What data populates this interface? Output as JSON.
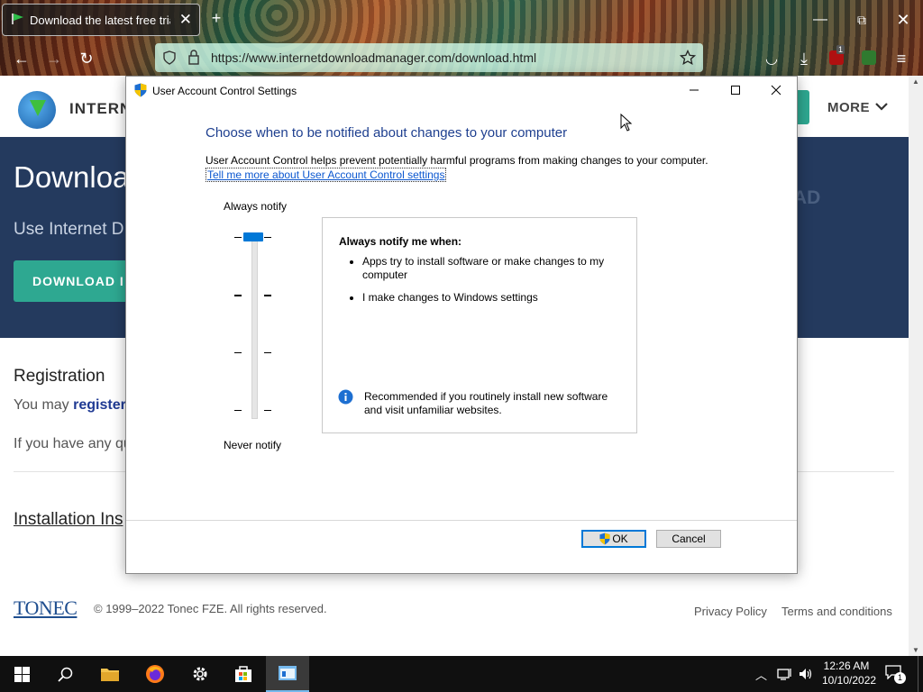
{
  "browser": {
    "tab_title": "Download the latest free trial v",
    "url": "https://www.internetdownloadmanager.com/download.html",
    "ublock_count": "1"
  },
  "site": {
    "brand": "INTERN",
    "more_label": "MORE",
    "hero_title": "Downloa",
    "hero_sub": "Use Internet D",
    "hero_right": "AD",
    "download_button": "DOWNLOAD I",
    "registration_heading": "Registration",
    "registration_text": "You may ",
    "register_link": "register",
    "contact_text": "If you have any qu",
    "installation_heading": "Installation Ins",
    "footer_logo": "TONEC",
    "copyright": "© 1999–2022 Tonec FZE. All rights reserved.",
    "privacy_policy": "Privacy Policy",
    "terms": "Terms and conditions"
  },
  "dialog": {
    "title": "User Account Control Settings",
    "heading": "Choose when to be notified about changes to your computer",
    "description": "User Account Control helps prevent potentially harmful programs from making changes to your computer.",
    "link": "Tell me more about User Account Control settings",
    "slider_top_label": "Always notify",
    "slider_bottom_label": "Never notify",
    "slider_level": 4,
    "slider_levels": 4,
    "info_title": "Always notify me when:",
    "bullets": [
      "Apps try to install software or make changes to my computer",
      "I make changes to Windows settings"
    ],
    "recommendation": "Recommended if you routinely install new software and visit unfamiliar websites.",
    "ok_label": "OK",
    "cancel_label": "Cancel"
  },
  "taskbar": {
    "time": "12:26 AM",
    "date": "10/10/2022",
    "notification_count": "1"
  },
  "colors": {
    "accent": "#0078d7",
    "hero_bg": "#243a5e",
    "download_button": "#2ea891",
    "heading_blue": "#1e3f8f"
  }
}
